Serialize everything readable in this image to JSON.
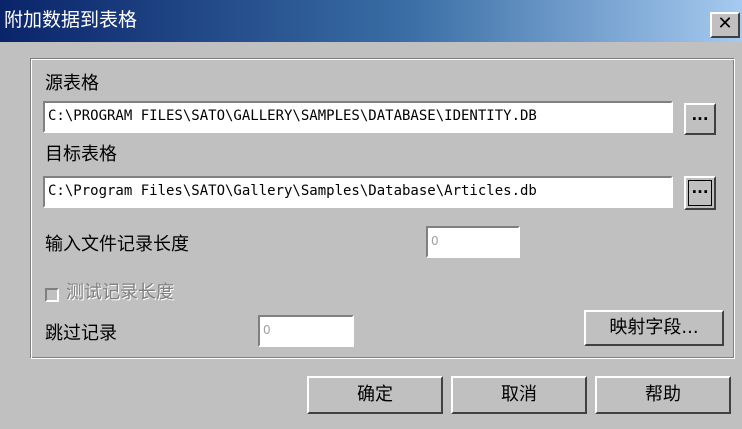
{
  "window": {
    "title": "附加数据到表格",
    "close_glyph": "✕"
  },
  "source": {
    "label": "源表格",
    "value": "C:\\PROGRAM FILES\\SATO\\GALLERY\\SAMPLES\\DATABASE\\IDENTITY.DB",
    "browse_label": "..."
  },
  "target": {
    "label": "目标表格",
    "value": "C:\\Program Files\\SATO\\Gallery\\Samples\\Database\\Articles.db",
    "browse_label": "..."
  },
  "record_length": {
    "label": "输入文件记录长度",
    "value": "0"
  },
  "test_record": {
    "label": "测试记录长度",
    "checked": false
  },
  "skip_records": {
    "label": "跳过记录",
    "value": "0"
  },
  "map_fields_label": "映射字段...",
  "buttons": {
    "ok": "确定",
    "cancel": "取消",
    "help": "帮助"
  }
}
